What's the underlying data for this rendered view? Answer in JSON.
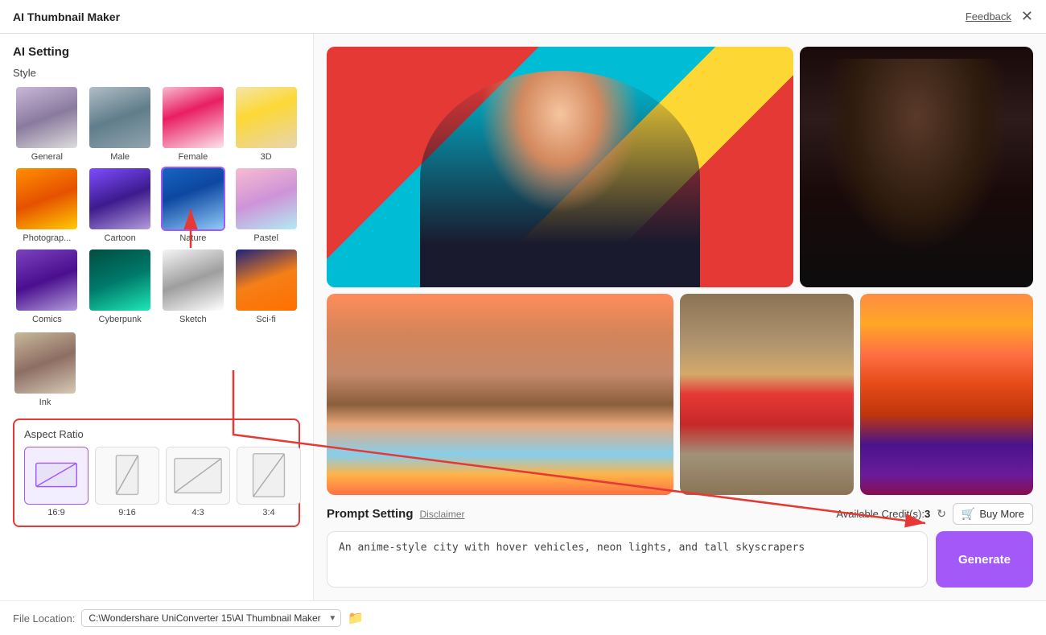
{
  "titleBar": {
    "title": "AI Thumbnail Maker",
    "feedbackLabel": "Feedback",
    "closeLabel": "✕"
  },
  "leftPanel": {
    "sectionTitle": "AI Setting",
    "styleLabel": "Style",
    "styles": [
      {
        "id": "general",
        "label": "General",
        "selected": false
      },
      {
        "id": "male",
        "label": "Male",
        "selected": false
      },
      {
        "id": "female",
        "label": "Female",
        "selected": false
      },
      {
        "id": "3d",
        "label": "3D",
        "selected": false
      },
      {
        "id": "photog",
        "label": "Photograp...",
        "selected": false
      },
      {
        "id": "cartoon",
        "label": "Cartoon",
        "selected": false
      },
      {
        "id": "nature",
        "label": "Nature",
        "selected": true
      },
      {
        "id": "pastel",
        "label": "Pastel",
        "selected": false
      },
      {
        "id": "comics",
        "label": "Comics",
        "selected": false
      },
      {
        "id": "cyberpunk",
        "label": "Cyberpunk",
        "selected": false
      },
      {
        "id": "sketch",
        "label": "Sketch",
        "selected": false
      },
      {
        "id": "sci-fi",
        "label": "Sci-fi",
        "selected": false
      },
      {
        "id": "ink",
        "label": "Ink",
        "selected": false
      }
    ],
    "aspectRatio": {
      "title": "Aspect Ratio",
      "options": [
        {
          "id": "16-9",
          "label": "16:9",
          "selected": true
        },
        {
          "id": "9-16",
          "label": "9:16",
          "selected": false
        },
        {
          "id": "4-3",
          "label": "4:3",
          "selected": false
        },
        {
          "id": "3-4",
          "label": "3:4",
          "selected": false
        }
      ]
    }
  },
  "rightPanel": {
    "promptSection": {
      "title": "Prompt Setting",
      "disclaimerLabel": "Disclaimer",
      "creditsLabel": "Available Credit(s):",
      "creditsValue": "3",
      "buyMoreLabel": "Buy More",
      "promptValue": "An anime-style city with hover vehicles, neon lights, and tall skyscrapers",
      "generateLabel": "Generate"
    },
    "fileLocation": {
      "label": "File Location:",
      "path": "C:\\Wondershare UniConverter 15\\AI Thumbnail Maker",
      "placeholder": "C:\\Wondershare UniConverter 15\\AI Thumbnail Maker"
    }
  }
}
